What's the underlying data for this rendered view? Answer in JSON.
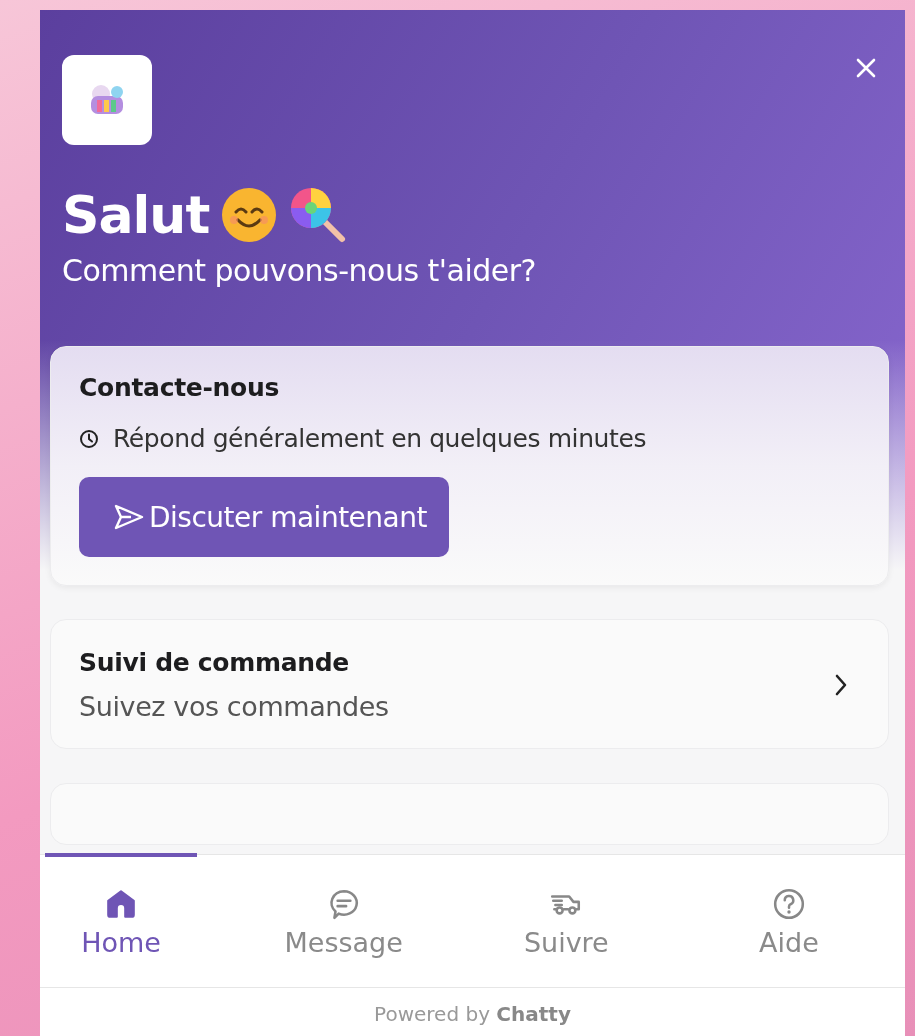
{
  "header": {
    "greeting": "Salut",
    "subtitle": "Comment pouvons-nous t'aider?"
  },
  "contact_card": {
    "title": "Contacte-nous",
    "response_time": "Répond généralement en quelques minutes",
    "button": "Discuter maintenant"
  },
  "order_card": {
    "title": "Suivi de commande",
    "subtitle": "Suivez vos commandes"
  },
  "tabs": [
    {
      "label": "Home",
      "selected": true
    },
    {
      "label": "Message",
      "selected": false
    },
    {
      "label": "Suivre",
      "selected": false
    },
    {
      "label": "Aide",
      "selected": false
    }
  ],
  "footer": "Powered by **Chatty**"
}
